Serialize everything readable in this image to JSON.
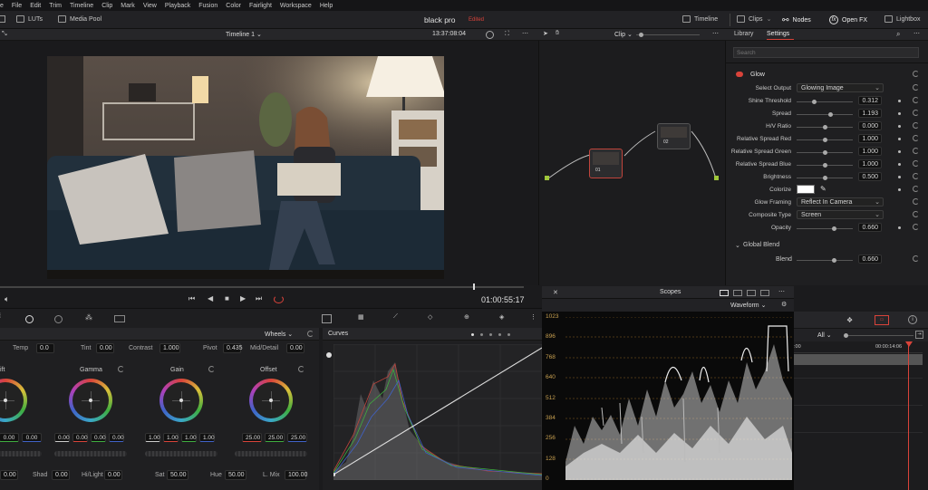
{
  "menu": [
    "e",
    "File",
    "Edit",
    "Trim",
    "Timeline",
    "Clip",
    "Mark",
    "View",
    "Playback",
    "Fusion",
    "Color",
    "Fairlight",
    "Workspace",
    "Help"
  ],
  "toolbar": {
    "luts": "LUTs",
    "media_pool": "Media Pool",
    "project_name": "black pro",
    "project_status": "Edited",
    "timeline": "Timeline",
    "clips": "Clips",
    "nodes": "Nodes",
    "open_fx": "Open FX",
    "lightbox": "Lightbox"
  },
  "viewer": {
    "timeline_name": "Timeline 1",
    "timecode": "13:37:08:04",
    "playhead_time": "01:00:55:17"
  },
  "node_editor": {
    "mode": "Clip",
    "nodes": [
      {
        "label": "01"
      },
      {
        "label": "02"
      }
    ]
  },
  "fx": {
    "tabs": {
      "library": "Library",
      "settings": "Settings"
    },
    "search_placeholder": "Search",
    "effect_name": "Glow",
    "params": [
      {
        "label": "Select Output",
        "type": "select",
        "value": "Glowing Image"
      },
      {
        "label": "Shine Threshold",
        "type": "slider",
        "value": "0.312",
        "level": 0.31
      },
      {
        "label": "Spread",
        "type": "slider",
        "value": "1.193",
        "level": 0.6
      },
      {
        "label": "H/V Ratio",
        "type": "slider",
        "value": "0.000",
        "level": 0.5
      },
      {
        "label": "Relative Spread Red",
        "type": "slider",
        "value": "1.000",
        "level": 0.5
      },
      {
        "label": "Relative Spread Green",
        "type": "slider",
        "value": "1.000",
        "level": 0.5
      },
      {
        "label": "Relative Spread Blue",
        "type": "slider",
        "value": "1.000",
        "level": 0.5
      },
      {
        "label": "Brightness",
        "type": "slider",
        "value": "0.500",
        "level": 0.5
      },
      {
        "label": "Colorize",
        "type": "color",
        "value": "#ffffff"
      },
      {
        "label": "Glow Framing",
        "type": "select",
        "value": "Reflect In Camera"
      },
      {
        "label": "Composite Type",
        "type": "select",
        "value": "Screen"
      },
      {
        "label": "Opacity",
        "type": "slider",
        "value": "0.660",
        "level": 0.66
      }
    ],
    "global_blend": "Global Blend",
    "blend": {
      "label": "Blend",
      "value": "0.660",
      "level": 0.66
    }
  },
  "wheels": {
    "title": "Wheels",
    "adjust": [
      {
        "label": "Temp",
        "value": "0.0"
      },
      {
        "label": "Tint",
        "value": "0.00"
      },
      {
        "label": "Contrast",
        "value": "1.000"
      },
      {
        "label": "Pivot",
        "value": "0.435"
      },
      {
        "label": "Mid/Detail",
        "value": "0.00"
      }
    ],
    "wheels": [
      {
        "name": "Lift",
        "label": "ift",
        "values": [
          "0.00",
          "0.00",
          "0.00"
        ]
      },
      {
        "name": "Gamma",
        "label": "Gamma",
        "values": [
          "0.00",
          "0.00",
          "0.00",
          "0.00"
        ]
      },
      {
        "name": "Gain",
        "label": "Gain",
        "values": [
          "1.00",
          "1.00",
          "1.00",
          "1.00"
        ]
      },
      {
        "name": "Offset",
        "label": "Offset",
        "values": [
          "25.00",
          "25.00",
          "25.00"
        ]
      }
    ],
    "bottom": [
      {
        "label": "",
        "value": "0.00"
      },
      {
        "label": "Shad",
        "value": "0.00"
      },
      {
        "label": "Hi/Light",
        "value": "0.00"
      },
      {
        "label": "Sat",
        "value": "50.00"
      },
      {
        "label": "Hue",
        "value": "50.00"
      },
      {
        "label": "L. Mix",
        "value": "100.00"
      }
    ]
  },
  "curves": {
    "title": "Curves"
  },
  "scopes": {
    "title": "Scopes",
    "mode": "Waveform",
    "scale": [
      "1023",
      "896",
      "768",
      "640",
      "512",
      "384",
      "256",
      "128",
      "0"
    ]
  },
  "keyframes": {
    "filter": "All",
    "time": "00:00:14:06",
    "start": ":00"
  },
  "colors": {
    "accent_red": "#d9433a",
    "waveform_grid": "#b07a2a"
  }
}
